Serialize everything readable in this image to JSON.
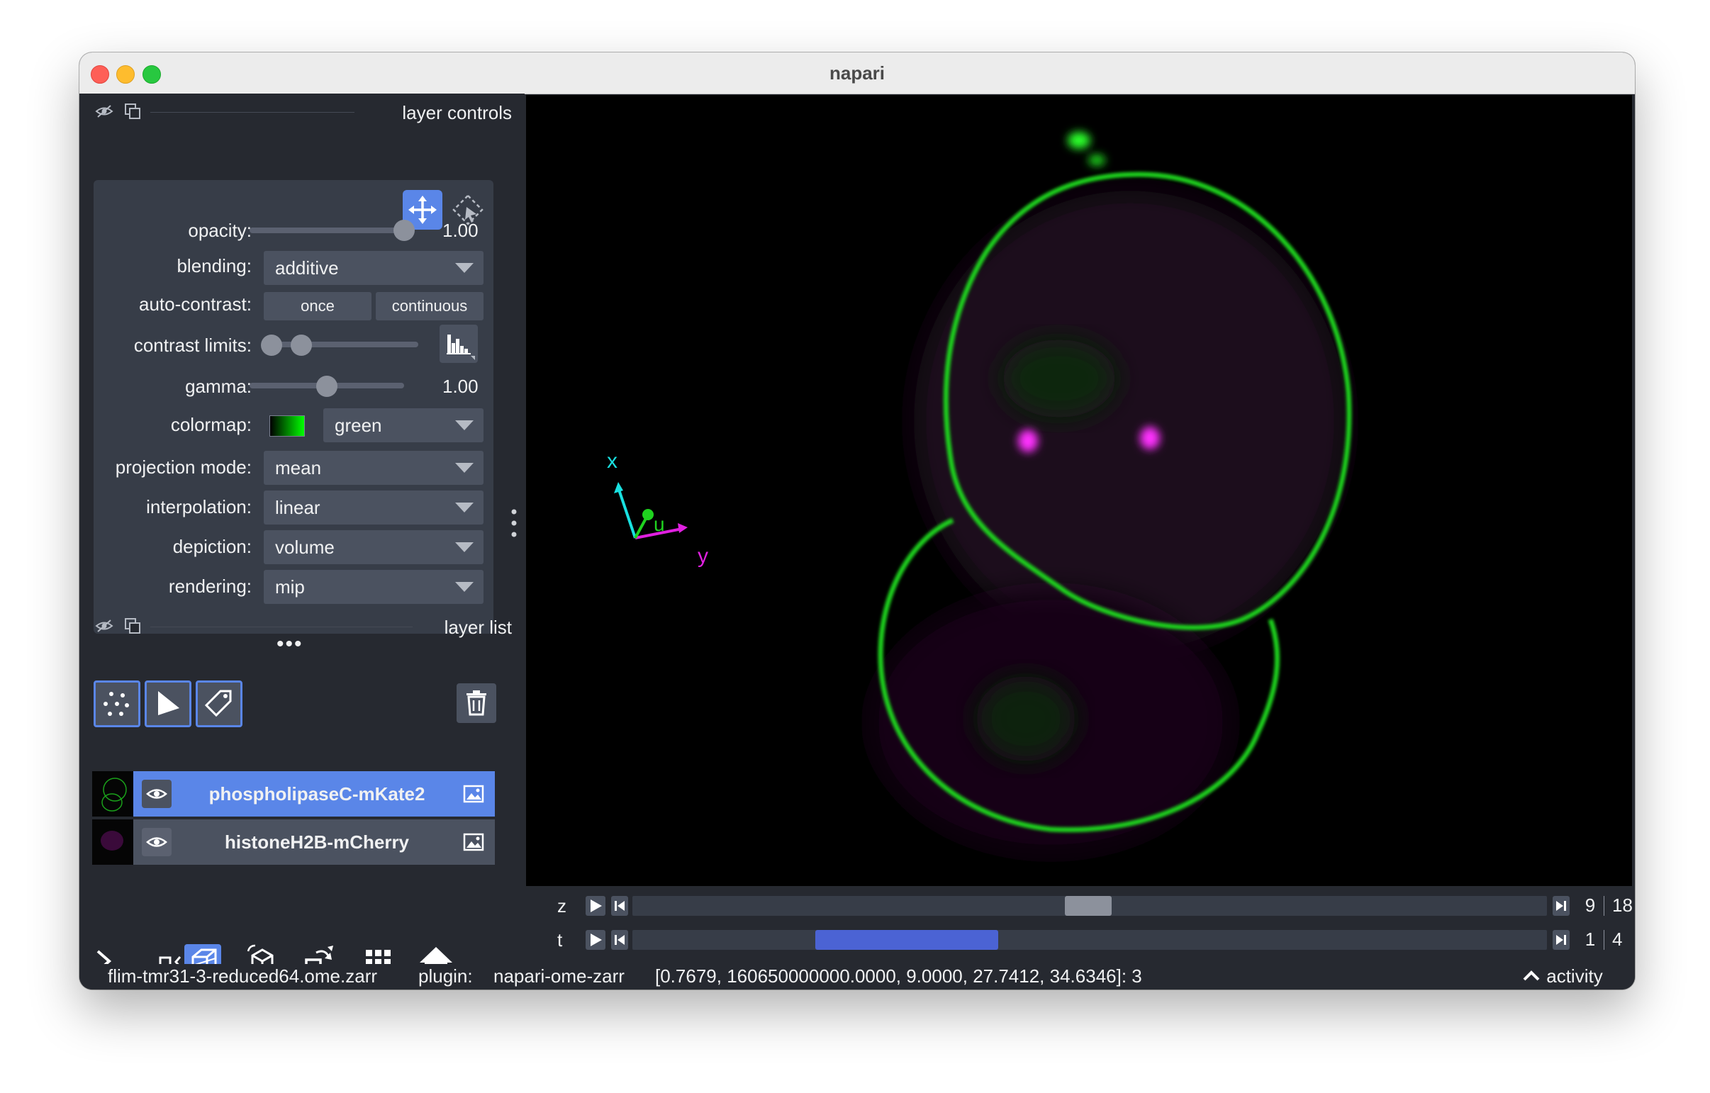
{
  "window": {
    "title": "napari"
  },
  "layer_controls": {
    "title": "layer controls",
    "opacity": {
      "label": "opacity:",
      "value": "1.00",
      "level": 1.0
    },
    "blending": {
      "label": "blending:",
      "value": "additive"
    },
    "auto_contrast": {
      "label": "auto-contrast:",
      "once": "once",
      "continuous": "continuous"
    },
    "contrast_limits": {
      "label": "contrast limits:",
      "low": 0.0,
      "high": 0.25
    },
    "gamma": {
      "label": "gamma:",
      "value": "1.00",
      "level": 0.5
    },
    "colormap": {
      "label": "colormap:",
      "value": "green"
    },
    "projection_mode": {
      "label": "projection mode:",
      "value": "mean"
    },
    "interpolation": {
      "label": "interpolation:",
      "value": "linear"
    },
    "depiction": {
      "label": "depiction:",
      "value": "volume"
    },
    "rendering": {
      "label": "rendering:",
      "value": "mip"
    }
  },
  "layer_list": {
    "title": "layer list",
    "layers": [
      {
        "name": "phospholipaseC-mKate2",
        "selected": true
      },
      {
        "name": "histoneH2B-mCherry",
        "selected": false
      }
    ]
  },
  "axes": {
    "x": "x",
    "y": "y",
    "u": "u"
  },
  "dims": {
    "z": {
      "label": "z",
      "current": "9",
      "max": "18"
    },
    "t": {
      "label": "t",
      "current": "1",
      "max": "4"
    }
  },
  "status": {
    "file": "flim-tmr31-3-reduced64.ome.zarr",
    "plugin_label": "plugin:",
    "plugin": "napari-ome-zarr",
    "coords": "[0.7679, 160650000000.0000, 9.0000, 27.7412, 34.6346]: 3",
    "activity": "activity"
  },
  "colors": {
    "accent": "#5a86e8",
    "background": "#262930",
    "panel": "#373d48",
    "membrane": "#1fd21f",
    "nucleus": "#e020e0"
  }
}
